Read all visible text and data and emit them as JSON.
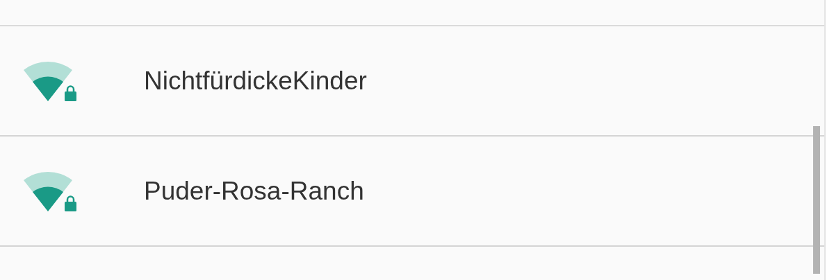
{
  "networks": [
    {
      "name": "NichtfürdickeKinder",
      "secured": true
    },
    {
      "name": "Puder-Rosa-Ranch",
      "secured": true
    }
  ]
}
